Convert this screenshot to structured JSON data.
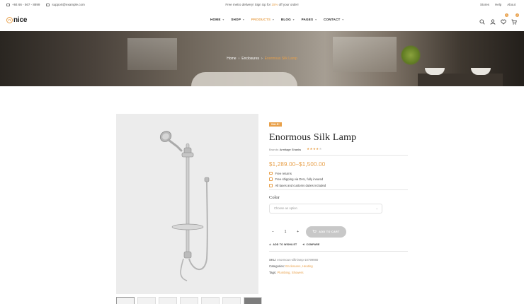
{
  "topbar": {
    "phone": "+84 66 - 567 - 8899",
    "email": "support@example.com",
    "promo_pre": "Free metro delivery! Sign Up for ",
    "promo_accent": "15%",
    "promo_post": " off your order!",
    "links": [
      "Stores",
      "Help",
      "About"
    ]
  },
  "header": {
    "logo_badge": "n",
    "logo_text": "nice",
    "nav": [
      {
        "label": "HOME"
      },
      {
        "label": "SHOP"
      },
      {
        "label": "PRODUCTS"
      },
      {
        "label": "BLOG"
      },
      {
        "label": "PAGES"
      },
      {
        "label": "CONTACT"
      }
    ],
    "wishlist_count": "0",
    "cart_count": "0"
  },
  "breadcrumb": {
    "home": "Home",
    "category": "Enclosures",
    "current": "Enormous Silk Lamp"
  },
  "product": {
    "badge": "SALE!",
    "title": "Enormous Silk Lamp",
    "brand_label": "Brands:",
    "brand_value": "Armitage Shanks",
    "rating": 4,
    "price": "$1,289.00–$1,500.00",
    "features": [
      "Free returns",
      "Free shipping via DHL, fully insured",
      "All taxes and customs duties included"
    ],
    "color_label": "Color",
    "color_placeholder": "Choose an option",
    "qty_minus": "−",
    "qty_value": "1",
    "qty_plus": "+",
    "add_to_cart": "ADD TO CART",
    "wishlist": "ADD TO WISHLIST",
    "compare": "COMPARE",
    "sku_label": "SKU:",
    "sku": "enormous-silk-lamp-10799980",
    "categories_label": "Categories:",
    "categories": "Enclosures, Heating",
    "tags_label": "Tags:",
    "tags": "Plumbing, Showers"
  },
  "colors": {
    "accent": "#e8a04a",
    "cart_button": "#c8c8c8"
  }
}
